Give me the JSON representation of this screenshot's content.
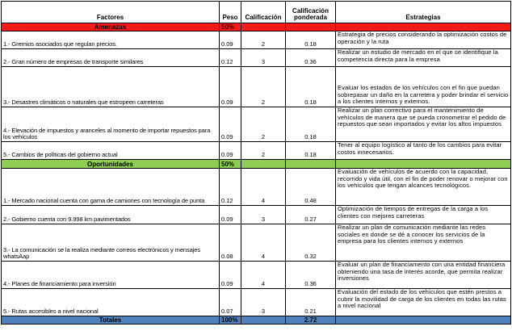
{
  "headers": {
    "factores": "Factores",
    "peso": "Peso",
    "calificacion": "Calificación",
    "calificacion_ponderada": "Calificación ponderada",
    "estrategias": "Estrategias"
  },
  "amenazas": {
    "title": "Amenazas",
    "peso": "50%",
    "rows": [
      {
        "factor": "1.- Gremios asociados que regulan precios.",
        "peso": "0.09",
        "calificacion": "2",
        "ponderada": "0.18",
        "estrategia": "Estrategia de precios considerando la optimización costos de operación y la ruta"
      },
      {
        "factor": "2.- Gran número de empresas de transporte similares",
        "peso": "0.12",
        "calificacion": "3",
        "ponderada": "0.36",
        "estrategia": "Realizar un estudio de mercado en el que se identifique la competencia directa para la empresa"
      },
      {
        "factor": "3.- Desastres climáticos o naturales que estropeen carreteras",
        "peso": "0.09",
        "calificacion": "2",
        "ponderada": "0.18",
        "estrategia": "Evaluar los estados de los vehículos con el fin que puedan sobrepasar un daño en la carretera y poder brindar el servicio a los clientes internos y externos."
      },
      {
        "factor": "4.- Elevación de impuestos y aranceles al momento de importar repuestos para los vehículos",
        "peso": "0.09",
        "calificacion": "2",
        "ponderada": "0.18",
        "estrategia": "Realizar un plan correctivo para el mantenimiento de vehículos de manera que se pueda cronometrar el pedido de repuestos que sean importados y evitar los altos impuestos"
      },
      {
        "factor": "5.- Cambios de políticas del gobierno actual",
        "peso": "0.09",
        "calificacion": "2",
        "ponderada": "0.18",
        "estrategia": "Tener al equipo logístico al tanto de los cambios para evitar costos innecesarios."
      }
    ]
  },
  "oportunidades": {
    "title": "Oportunidades",
    "peso": "50%",
    "rows": [
      {
        "factor": "1.- Mercado nacional cuenta con gama de camiones con tecnología de punta",
        "peso": "0.12",
        "calificacion": "4",
        "ponderada": "0.48",
        "estrategia": "Evaluación de vehículos de acuerdo con la capacidad, recorrido y vida útil, con el fin de poder renovar o mejorar con los vehículos que tengan alcances tecnológicos."
      },
      {
        "factor": "2.- Gobierno cuenta con 9.998 km pavimentados",
        "peso": "0.09",
        "calificacion": "3",
        "ponderada": "0.27",
        "estrategia": "Optimización de tiempos de entregas de la carga a los clientes con mejores carreteras"
      },
      {
        "factor": "3.- La comunicación se la realiza mediante correos electrónicos y mensajes whatsAap",
        "peso": "0.08",
        "calificacion": "4",
        "ponderada": "0.32",
        "estrategia": "Realizar un plan de comunicación mediante las redes sociales en donde se dé a conocer los servicios de la empresa para los clientes internos y externos"
      },
      {
        "factor": "4.- Planes de financiamiento para inversión",
        "peso": "0.09",
        "calificacion": "4",
        "ponderada": "0.36",
        "estrategia": "Evaluar un plan de financiamento con una entidad financiera obteniendo una tasa de interés acorde, que permita realizar inversiones"
      },
      {
        "factor": "5.- Rutas accesibles a nivel nacional",
        "peso": "0.07",
        "calificacion": "3",
        "ponderada": "0.21",
        "estrategia": "Evaluación del estado de los vehículos que estén prestos a cubrir la movilidad de carga de los clientes en todas las rutas a nivel nacional"
      }
    ]
  },
  "totales": {
    "label": "Totales",
    "peso": "100%",
    "ponderada": "2.72"
  }
}
